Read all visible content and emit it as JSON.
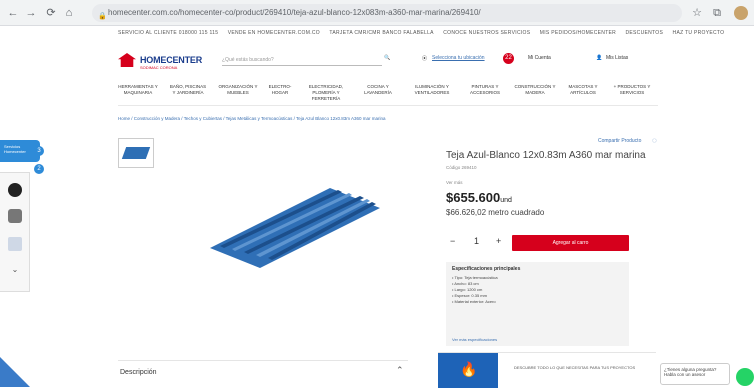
{
  "browser": {
    "url": "homecenter.com.co/homecenter-co/product/269410/teja-azul-blanco-12x083m-a360-mar-marina/269410/",
    "back_label": "←",
    "forward_label": "→",
    "reload_label": "⟳",
    "home_label": "⌂"
  },
  "topbar": {
    "items": [
      "SERVICIO AL CLIENTE 018000 115 115",
      "VENDE EN HOMECENTER.COM.CO",
      "TARJETA CMR/CMR BANCO FALABELLA",
      "CONOCE NUESTROS SERVICIOS",
      "MIS PEDIDOS/HOMECENTER",
      "DESCUENTOS",
      "HAZ TU PROYECTO"
    ]
  },
  "header": {
    "logo_text": "HOMECENTER",
    "logo_sub": "SODIMAC CORONA",
    "search_placeholder": "¿Qué estás buscando?",
    "location": "Selecciona tu ubicación",
    "cart_count": "22",
    "account_label": "Mi Cuenta",
    "wishlist_label": "Mis Listas"
  },
  "categories": [
    "HERRAMIENTAS Y MAQUINARIA",
    "BAÑO, PISCINAS Y JARDINERÍA",
    "ORGANIZACIÓN Y MUEBLES",
    "ELECTRO-HOGAR",
    "ELECTRICIDAD, PLOMERÍA Y FERRETERÍA",
    "COCINA Y LAVANDERÍA",
    "ILUMINACIÓN Y VENTILADORES",
    "PINTURAS Y ACCESORIOS",
    "CONSTRUCCIÓN Y MADERA",
    "MASCOTAS Y ARTÍCULOS",
    "+ PRODUCTOS Y SERVICIOS"
  ],
  "breadcrumb": "Home  /  Construcción y Madera  /  Techos y Cubiertas  /  Tejas Metálicas y Termoacústicas  /  Teja Azul Blanco 12x0.83m A360 mar marina",
  "left_toolbar": {
    "head_label": "Servicios Homecenter",
    "dot_1": "3",
    "dot_2": "2"
  },
  "product": {
    "share_label": "Compartir Producto",
    "title": "Teja Azul-Blanco 12x0.83m A360 mar marina",
    "code": "Código 269410",
    "compare_text": "Ver más",
    "price": "$655.600",
    "price_unit": "und",
    "price_m2": "$66.626,02 metro cuadrado",
    "qty_minus": "−",
    "qty_value": "1",
    "qty_plus": "+",
    "add_button": "Agregar al carro"
  },
  "specs": {
    "title": "Especificaciones principales",
    "rows": [
      "• Tipo: Teja termoacústica",
      "• Ancho: 83 cm",
      "• Largo: 1200 cm",
      "• Espesor: 0.35 mm",
      "• Material exterior: Acero"
    ],
    "link": "Ver más especificaciones"
  },
  "footer": {
    "description_label": "Descripción",
    "description_chevron": "⌃",
    "banner_text": "DESCUBRE TODO LO QUE NECESITAS PARA TUS PROYECTOS",
    "chat_text": "¿Tienes alguna pregunta? Habla con un asesor",
    "scroll_mark": "⌄"
  },
  "colors": {
    "brand_blue": "#1a3c8c",
    "brand_red": "#d6001c",
    "roof_blue": "#2e6fb5"
  }
}
